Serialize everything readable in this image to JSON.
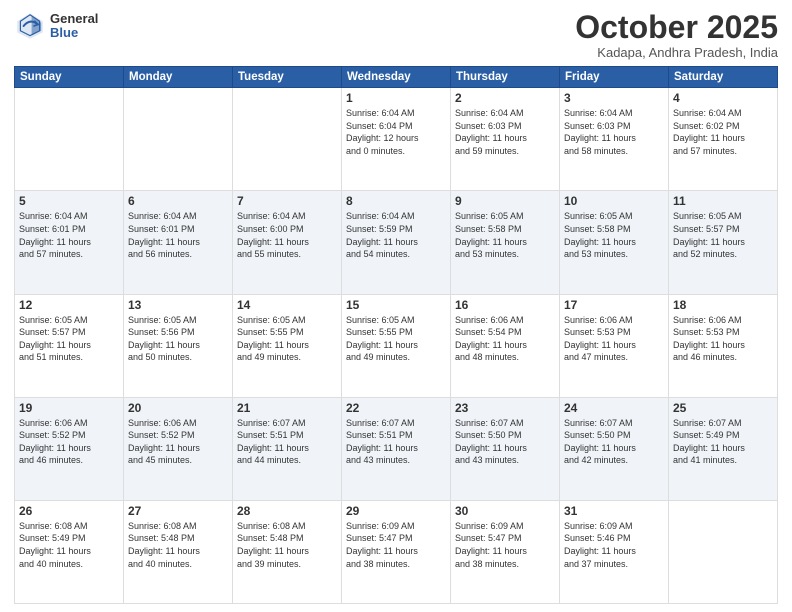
{
  "logo": {
    "general": "General",
    "blue": "Blue"
  },
  "header": {
    "month": "October 2025",
    "location": "Kadapa, Andhra Pradesh, India"
  },
  "weekdays": [
    "Sunday",
    "Monday",
    "Tuesday",
    "Wednesday",
    "Thursday",
    "Friday",
    "Saturday"
  ],
  "weeks": [
    [
      {
        "day": "",
        "info": ""
      },
      {
        "day": "",
        "info": ""
      },
      {
        "day": "",
        "info": ""
      },
      {
        "day": "1",
        "info": "Sunrise: 6:04 AM\nSunset: 6:04 PM\nDaylight: 12 hours\nand 0 minutes."
      },
      {
        "day": "2",
        "info": "Sunrise: 6:04 AM\nSunset: 6:03 PM\nDaylight: 11 hours\nand 59 minutes."
      },
      {
        "day": "3",
        "info": "Sunrise: 6:04 AM\nSunset: 6:03 PM\nDaylight: 11 hours\nand 58 minutes."
      },
      {
        "day": "4",
        "info": "Sunrise: 6:04 AM\nSunset: 6:02 PM\nDaylight: 11 hours\nand 57 minutes."
      }
    ],
    [
      {
        "day": "5",
        "info": "Sunrise: 6:04 AM\nSunset: 6:01 PM\nDaylight: 11 hours\nand 57 minutes."
      },
      {
        "day": "6",
        "info": "Sunrise: 6:04 AM\nSunset: 6:01 PM\nDaylight: 11 hours\nand 56 minutes."
      },
      {
        "day": "7",
        "info": "Sunrise: 6:04 AM\nSunset: 6:00 PM\nDaylight: 11 hours\nand 55 minutes."
      },
      {
        "day": "8",
        "info": "Sunrise: 6:04 AM\nSunset: 5:59 PM\nDaylight: 11 hours\nand 54 minutes."
      },
      {
        "day": "9",
        "info": "Sunrise: 6:05 AM\nSunset: 5:58 PM\nDaylight: 11 hours\nand 53 minutes."
      },
      {
        "day": "10",
        "info": "Sunrise: 6:05 AM\nSunset: 5:58 PM\nDaylight: 11 hours\nand 53 minutes."
      },
      {
        "day": "11",
        "info": "Sunrise: 6:05 AM\nSunset: 5:57 PM\nDaylight: 11 hours\nand 52 minutes."
      }
    ],
    [
      {
        "day": "12",
        "info": "Sunrise: 6:05 AM\nSunset: 5:57 PM\nDaylight: 11 hours\nand 51 minutes."
      },
      {
        "day": "13",
        "info": "Sunrise: 6:05 AM\nSunset: 5:56 PM\nDaylight: 11 hours\nand 50 minutes."
      },
      {
        "day": "14",
        "info": "Sunrise: 6:05 AM\nSunset: 5:55 PM\nDaylight: 11 hours\nand 49 minutes."
      },
      {
        "day": "15",
        "info": "Sunrise: 6:05 AM\nSunset: 5:55 PM\nDaylight: 11 hours\nand 49 minutes."
      },
      {
        "day": "16",
        "info": "Sunrise: 6:06 AM\nSunset: 5:54 PM\nDaylight: 11 hours\nand 48 minutes."
      },
      {
        "day": "17",
        "info": "Sunrise: 6:06 AM\nSunset: 5:53 PM\nDaylight: 11 hours\nand 47 minutes."
      },
      {
        "day": "18",
        "info": "Sunrise: 6:06 AM\nSunset: 5:53 PM\nDaylight: 11 hours\nand 46 minutes."
      }
    ],
    [
      {
        "day": "19",
        "info": "Sunrise: 6:06 AM\nSunset: 5:52 PM\nDaylight: 11 hours\nand 46 minutes."
      },
      {
        "day": "20",
        "info": "Sunrise: 6:06 AM\nSunset: 5:52 PM\nDaylight: 11 hours\nand 45 minutes."
      },
      {
        "day": "21",
        "info": "Sunrise: 6:07 AM\nSunset: 5:51 PM\nDaylight: 11 hours\nand 44 minutes."
      },
      {
        "day": "22",
        "info": "Sunrise: 6:07 AM\nSunset: 5:51 PM\nDaylight: 11 hours\nand 43 minutes."
      },
      {
        "day": "23",
        "info": "Sunrise: 6:07 AM\nSunset: 5:50 PM\nDaylight: 11 hours\nand 43 minutes."
      },
      {
        "day": "24",
        "info": "Sunrise: 6:07 AM\nSunset: 5:50 PM\nDaylight: 11 hours\nand 42 minutes."
      },
      {
        "day": "25",
        "info": "Sunrise: 6:07 AM\nSunset: 5:49 PM\nDaylight: 11 hours\nand 41 minutes."
      }
    ],
    [
      {
        "day": "26",
        "info": "Sunrise: 6:08 AM\nSunset: 5:49 PM\nDaylight: 11 hours\nand 40 minutes."
      },
      {
        "day": "27",
        "info": "Sunrise: 6:08 AM\nSunset: 5:48 PM\nDaylight: 11 hours\nand 40 minutes."
      },
      {
        "day": "28",
        "info": "Sunrise: 6:08 AM\nSunset: 5:48 PM\nDaylight: 11 hours\nand 39 minutes."
      },
      {
        "day": "29",
        "info": "Sunrise: 6:09 AM\nSunset: 5:47 PM\nDaylight: 11 hours\nand 38 minutes."
      },
      {
        "day": "30",
        "info": "Sunrise: 6:09 AM\nSunset: 5:47 PM\nDaylight: 11 hours\nand 38 minutes."
      },
      {
        "day": "31",
        "info": "Sunrise: 6:09 AM\nSunset: 5:46 PM\nDaylight: 11 hours\nand 37 minutes."
      },
      {
        "day": "",
        "info": ""
      }
    ]
  ]
}
